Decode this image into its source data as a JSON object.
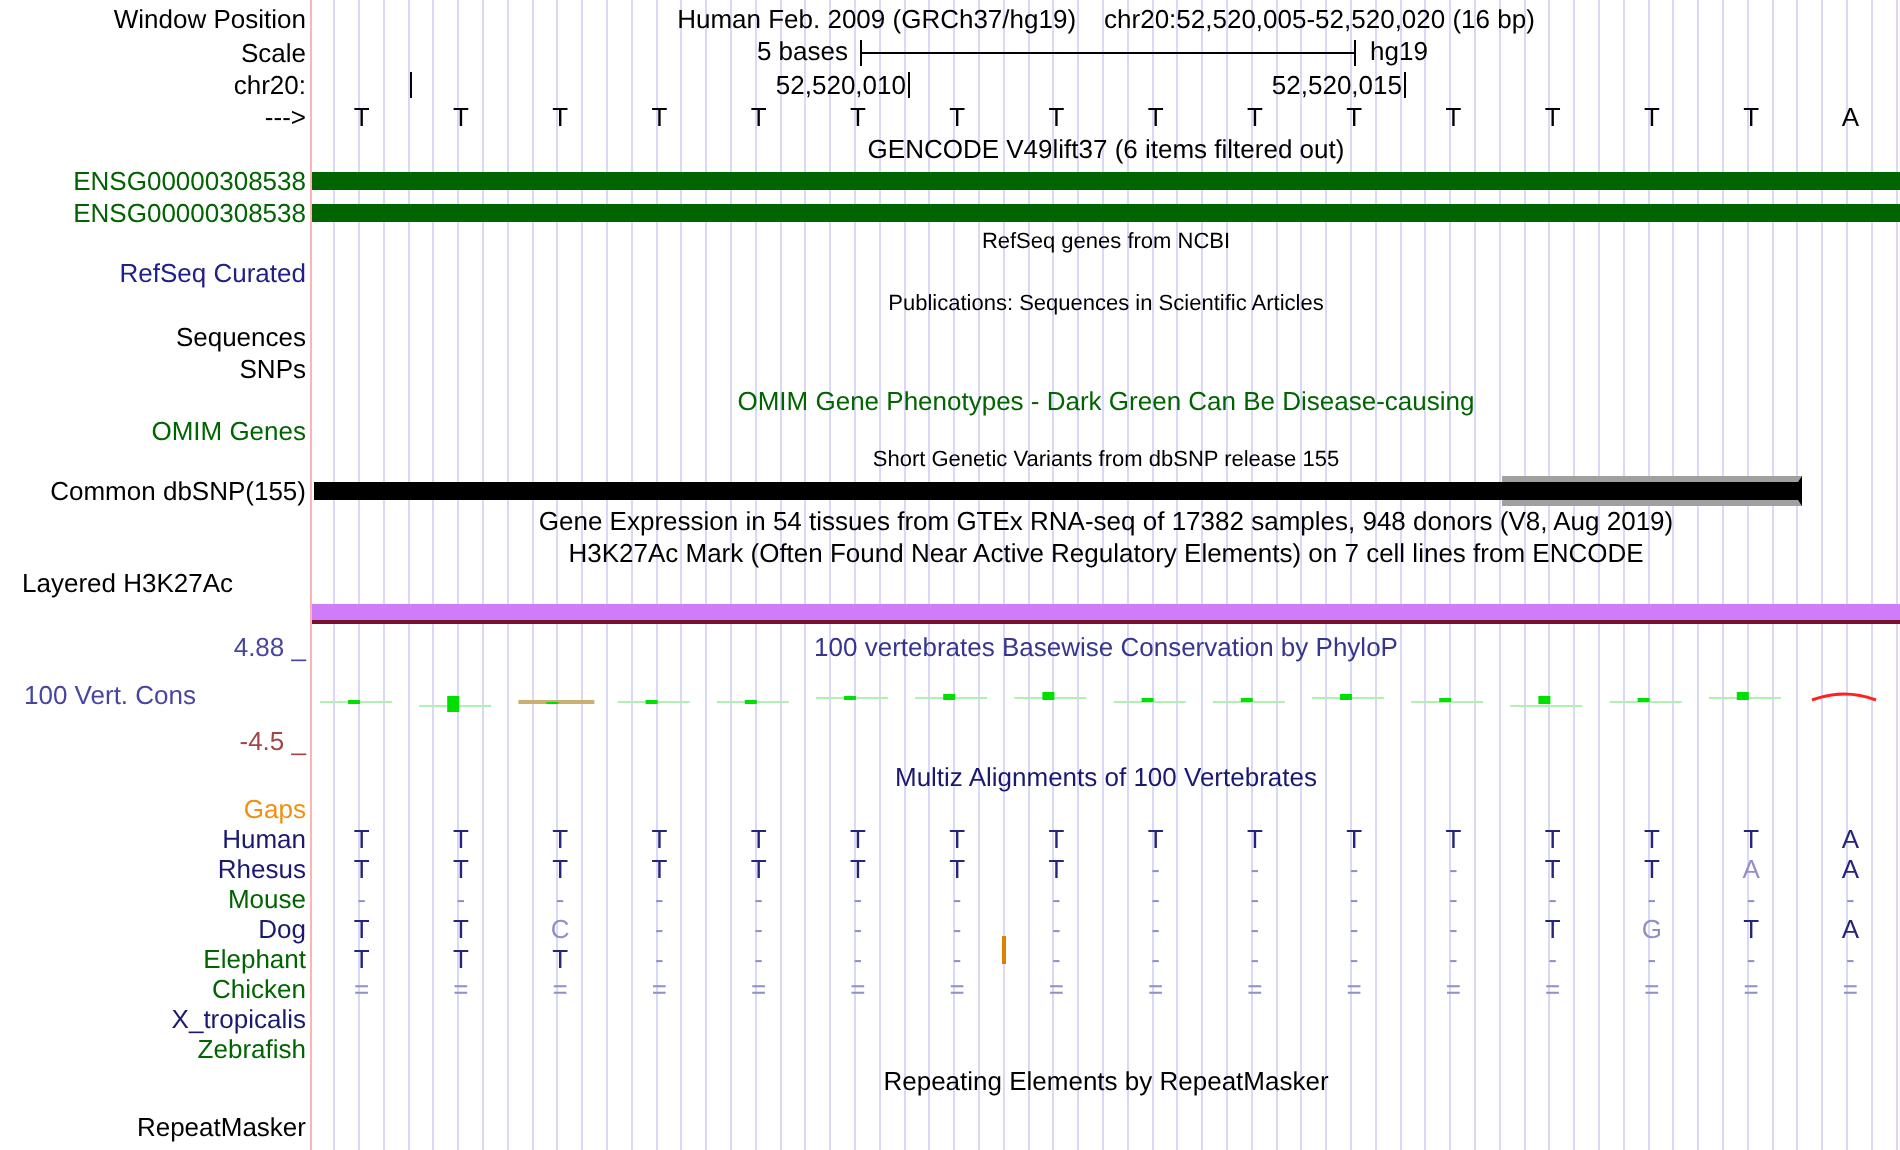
{
  "window_position": {
    "label": "Window Position",
    "title": "Human Feb. 2009 (GRCh37/hg19)",
    "range": "chr20:52,520,005-52,520,020 (16 bp)"
  },
  "scale": {
    "label": "Scale",
    "text": "5 bases",
    "assembly": "hg19"
  },
  "ruler": {
    "label": "chr20:",
    "ticks": [
      "52,520,010",
      "52,520,015"
    ]
  },
  "sequence": {
    "label": "--->",
    "bases": [
      "T",
      "T",
      "T",
      "T",
      "T",
      "T",
      "T",
      "T",
      "T",
      "T",
      "T",
      "T",
      "T",
      "T",
      "T",
      "A"
    ]
  },
  "gencode": {
    "title": "GENCODE V49lift37 (6 items filtered out)",
    "genes": [
      "ENSG00000308538",
      "ENSG00000308538"
    ]
  },
  "refseq": {
    "title": "RefSeq genes from NCBI",
    "label": "RefSeq Curated"
  },
  "publications": {
    "title": "Publications: Sequences in Scientific Articles",
    "labels": [
      "Sequences",
      "SNPs"
    ]
  },
  "omim": {
    "title": "OMIM Gene Phenotypes - Dark Green Can Be Disease-causing",
    "label": "OMIM Genes"
  },
  "dbsnp": {
    "title": "Short Genetic Variants from dbSNP release 155",
    "label": "Common dbSNP(155)"
  },
  "gtex": {
    "title": "Gene Expression in 54 tissues from GTEx RNA-seq of 17382 samples, 948 donors (V8, Aug 2019)"
  },
  "h3k27ac": {
    "title": "H3K27Ac Mark (Often Found Near Active Regulatory Elements) on 7 cell lines from ENCODE",
    "label": "Layered H3K27Ac"
  },
  "conservation": {
    "title": "100 vertebrates Basewise Conservation by PhyloP",
    "label": "100 Vert. Cons",
    "max": "4.88 _",
    "min": "-4.5 _"
  },
  "multiz": {
    "title": "Multiz Alignments of 100 Vertebrates",
    "gaps_label": "Gaps",
    "species": [
      {
        "name": "Human",
        "color": "#191970",
        "bases": [
          "T",
          "T",
          "T",
          "T",
          "T",
          "T",
          "T",
          "T",
          "T",
          "T",
          "T",
          "T",
          "T",
          "T",
          "T",
          "A"
        ]
      },
      {
        "name": "Rhesus",
        "color": "#191970",
        "bases": [
          "T",
          "T",
          "T",
          "T",
          "T",
          "T",
          "T",
          "T",
          "-",
          "-",
          "-",
          "-",
          "T",
          "T",
          "A",
          "A"
        ]
      },
      {
        "name": "Mouse",
        "color": "#006400",
        "bases": [
          "-",
          "-",
          "-",
          "-",
          "-",
          "-",
          "-",
          "-",
          "-",
          "-",
          "-",
          "-",
          "-",
          "-",
          "-",
          "-"
        ]
      },
      {
        "name": "Dog",
        "color": "#191970",
        "bases": [
          "T",
          "T",
          "C",
          "-",
          "-",
          "-",
          "-",
          "-",
          "-",
          "-",
          "-",
          "-",
          "T",
          "G",
          "T",
          "A"
        ]
      },
      {
        "name": "Elephant",
        "color": "#006400",
        "bases": [
          "T",
          "T",
          "T",
          "-",
          "-",
          "-",
          "-",
          "-",
          "-",
          "-",
          "-",
          "-",
          "-",
          "-",
          "-",
          "-"
        ]
      },
      {
        "name": "Chicken",
        "color": "#006400",
        "bases": [
          "=",
          "=",
          "=",
          "=",
          "=",
          "=",
          "=",
          "=",
          "=",
          "=",
          "=",
          "=",
          "=",
          "=",
          "=",
          "="
        ]
      },
      {
        "name": "X_tropicalis",
        "color": "#191970"
      },
      {
        "name": "Zebrafish",
        "color": "#006400"
      }
    ]
  },
  "repeatmasker": {
    "title": "Repeating Elements by RepeatMasker",
    "label": "RepeatMasker"
  }
}
